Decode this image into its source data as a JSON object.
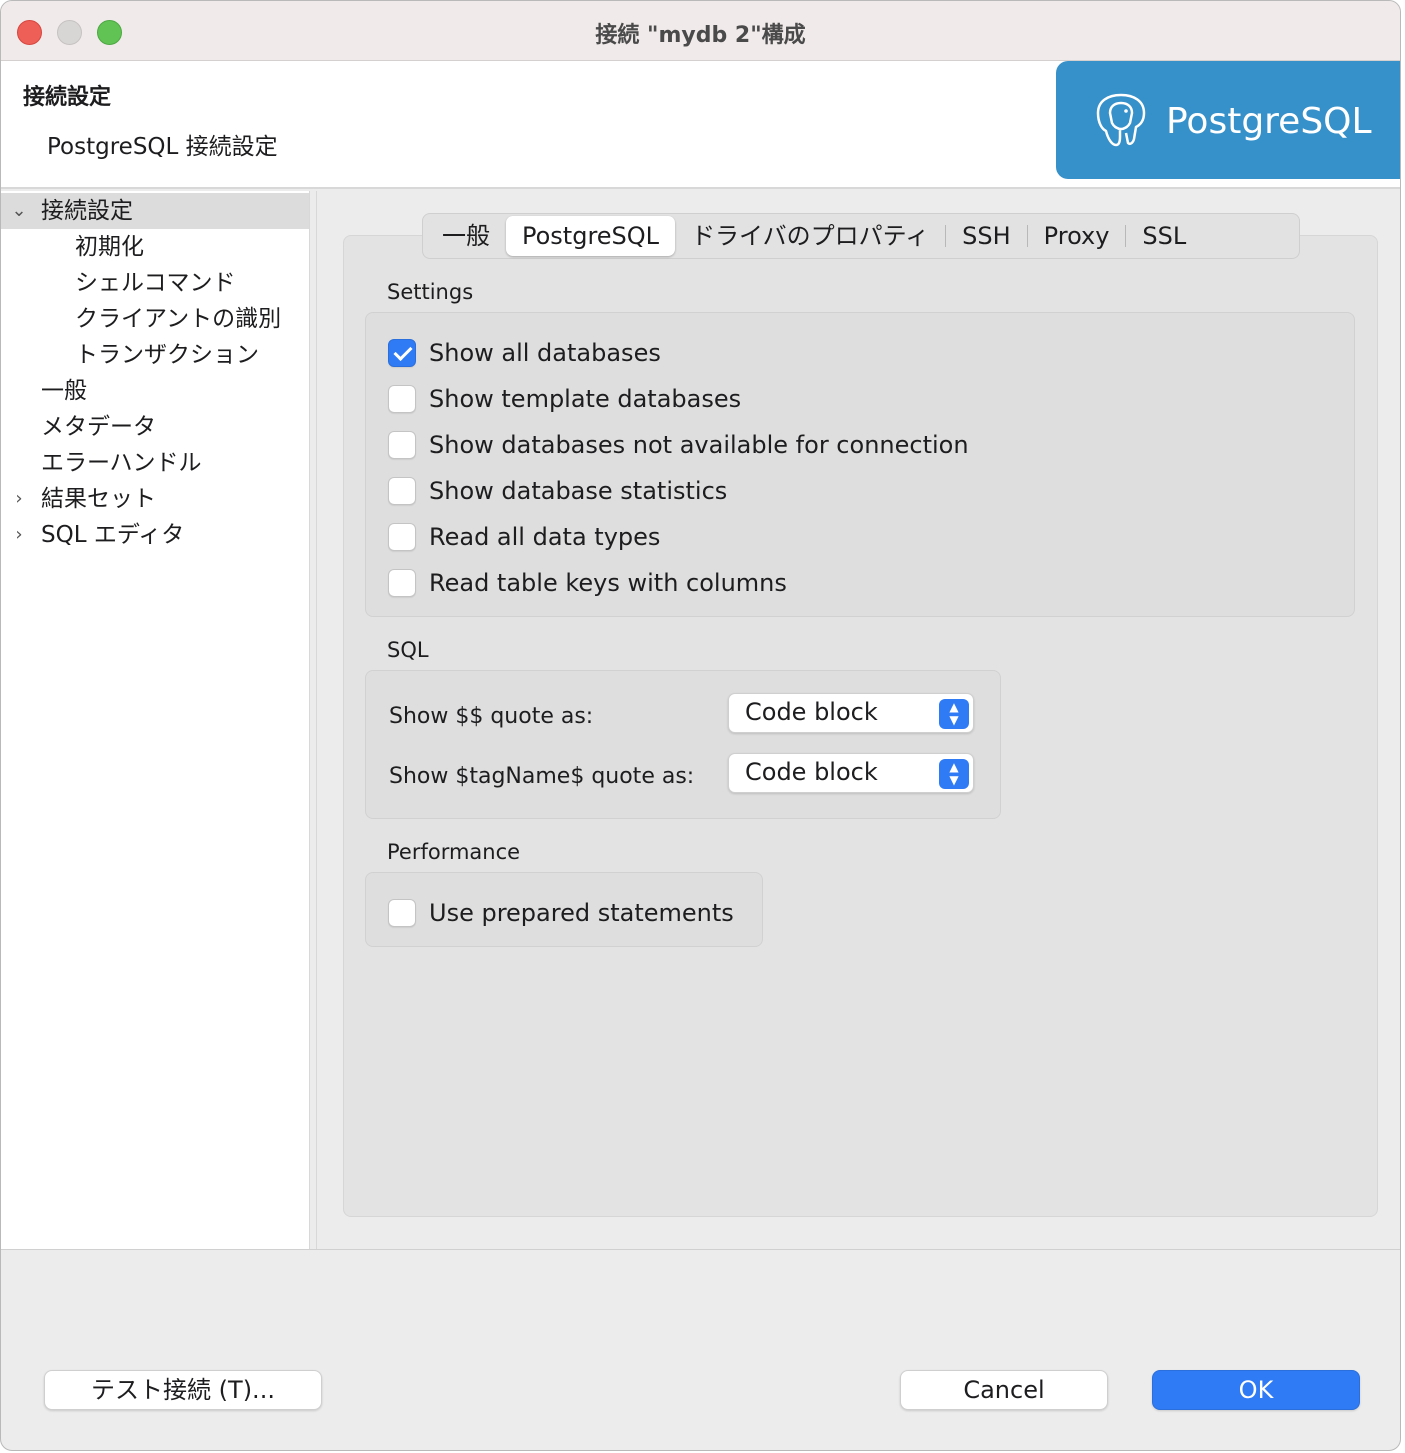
{
  "window": {
    "title": "接続 \"mydb 2\"構成"
  },
  "header": {
    "title": "接続設定",
    "subtitle": "PostgreSQL 接続設定",
    "logo_text": "PostgreSQL",
    "logo_color": "#3690c9"
  },
  "sidebar": {
    "items": [
      {
        "label": "接続設定",
        "arrow": "chevron-down-icon",
        "arrow_glyph": "⌄",
        "selected": true
      },
      {
        "label": "初期化"
      },
      {
        "label": "シェルコマンド"
      },
      {
        "label": "クライアントの識別"
      },
      {
        "label": "トランザクション"
      },
      {
        "label": "一般"
      },
      {
        "label": "メタデータ"
      },
      {
        "label": "エラーハンドル"
      },
      {
        "label": "結果セット",
        "arrow": "chevron-right-icon",
        "arrow_glyph": "›"
      },
      {
        "label": "SQL エディタ",
        "arrow": "chevron-right-icon",
        "arrow_glyph": "›"
      }
    ]
  },
  "tabs": [
    {
      "label": "一般"
    },
    {
      "label": "PostgreSQL",
      "active": true
    },
    {
      "label": "ドライバのプロパティ"
    },
    {
      "label": "SSH"
    },
    {
      "label": "Proxy"
    },
    {
      "label": "SSL"
    }
  ],
  "settings": {
    "label": "Settings",
    "options": [
      {
        "label": "Show all databases",
        "checked": true
      },
      {
        "label": "Show template databases",
        "checked": false
      },
      {
        "label": "Show databases not available for connection",
        "checked": false
      },
      {
        "label": "Show database statistics",
        "checked": false
      },
      {
        "label": "Read all data types",
        "checked": false
      },
      {
        "label": "Read table keys with columns",
        "checked": false
      }
    ]
  },
  "sql": {
    "label": "SQL",
    "fields": [
      {
        "label": "Show $$ quote as:",
        "value": "Code block"
      },
      {
        "label": "Show $tagName$ quote as:",
        "value": "Code block"
      }
    ]
  },
  "performance": {
    "label": "Performance",
    "options": [
      {
        "label": "Use prepared statements",
        "checked": false
      }
    ]
  },
  "footer": {
    "test_connection": "テスト接続 (T)...",
    "cancel": "Cancel",
    "ok": "OK"
  },
  "colors": {
    "accent": "#2f7bf5",
    "close": "#ee5f57",
    "maximize": "#60c354"
  }
}
